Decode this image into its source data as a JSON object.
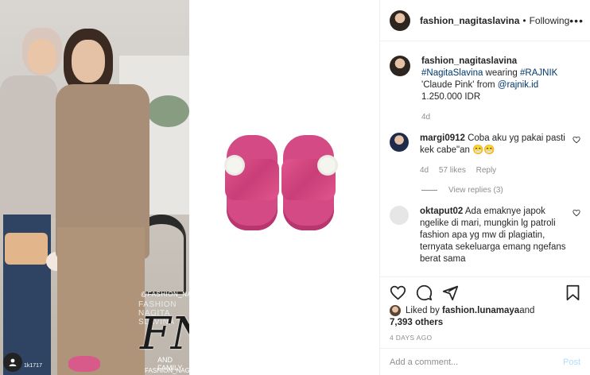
{
  "media": {
    "watermark_top": "@FASHION_NAGITASLAVINA",
    "watermark_name": "FASHION NAGITA SLAVINA",
    "watermark_logo": "FNS",
    "watermark_family": "AND FAMILY",
    "watermark_handle": "FASHION_NAGITASLAVINA",
    "user_tag": "1k1717"
  },
  "header": {
    "username": "fashion_nagitaslavina",
    "separator": "•",
    "follow_label": "Following",
    "more_label": "•••"
  },
  "caption": {
    "username": "fashion_nagitaslavina",
    "hashtag": "#NagitaSlavina",
    "text_1": " wearing ",
    "hashtag_2": "#RAJNIK",
    "text_2": "'Claude Pink' from ",
    "mention": "@rajnik.id",
    "price": "1.250.000 IDR",
    "time": "4d"
  },
  "comments": [
    {
      "username": "margi0912",
      "text": " Coba aku yg pakai pasti kek cabe\"an 😁😁",
      "time": "4d",
      "likes": "57 likes",
      "reply_label": "Reply",
      "view_replies": "View replies (3)"
    },
    {
      "username": "oktaput02",
      "text": " Ada emaknye japok ngelike di mari, mungkin lg patroli fashion apa yg mw di plagiatin, ternyata sekeluarga emang ngefans berat sama"
    }
  ],
  "actions": {
    "liked_prefix": "Liked by ",
    "liked_user": "fashion.lunamaya",
    "liked_and": " and",
    "liked_others": "7,393 others",
    "timestamp": "4 DAYS AGO"
  },
  "add_comment": {
    "placeholder": "Add a comment...",
    "post_label": "Post"
  },
  "colors": {
    "link": "#00376b",
    "muted": "#8e8e8e",
    "post_disabled": "#b3dbff",
    "sandal_pink": "#d44a85"
  }
}
